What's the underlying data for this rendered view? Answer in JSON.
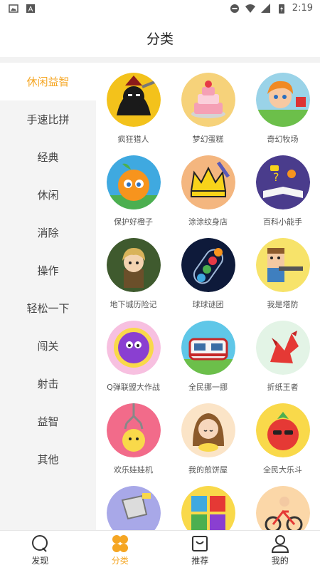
{
  "status_bar": {
    "time": "2:19"
  },
  "header": {
    "title": "分类"
  },
  "sidebar": {
    "items": [
      {
        "label": "休闲益智",
        "active": true
      },
      {
        "label": "手速比拼"
      },
      {
        "label": "经典"
      },
      {
        "label": "休闲"
      },
      {
        "label": "消除"
      },
      {
        "label": "操作"
      },
      {
        "label": "轻松一下"
      },
      {
        "label": "闯关"
      },
      {
        "label": "射击"
      },
      {
        "label": "益智"
      },
      {
        "label": "其他"
      }
    ]
  },
  "games": [
    {
      "name": "疯狂猎人",
      "icon": "hunter-icon"
    },
    {
      "name": "梦幻蛋糕",
      "icon": "cake-icon"
    },
    {
      "name": "奇幻牧场",
      "icon": "ranch-girl-icon"
    },
    {
      "name": "保护好橙子",
      "icon": "orange-icon"
    },
    {
      "name": "涂涂纹身店",
      "icon": "crown-tattoo-icon"
    },
    {
      "name": "百科小能手",
      "icon": "encyclopedia-book-icon"
    },
    {
      "name": "地下城历险记",
      "icon": "dungeon-hero-icon"
    },
    {
      "name": "球球谜团",
      "icon": "ball-tube-icon"
    },
    {
      "name": "我是塔防",
      "icon": "tower-defense-icon"
    },
    {
      "name": "Q弹联盟大作战",
      "icon": "purple-ball-icon"
    },
    {
      "name": "全民挪一挪",
      "icon": "train-icon"
    },
    {
      "name": "折纸王者",
      "icon": "paper-rooster-icon"
    },
    {
      "name": "欢乐娃娃机",
      "icon": "claw-machine-icon"
    },
    {
      "name": "我的煎饼屋",
      "icon": "pancake-girl-icon"
    },
    {
      "name": "全民大乐斗",
      "icon": "tomato-icon"
    },
    {
      "name": "",
      "icon": "saw-icon"
    },
    {
      "name": "",
      "icon": "jigsaw-icon"
    },
    {
      "name": "",
      "icon": "bike-icon"
    }
  ],
  "tabbar": {
    "tabs": [
      {
        "label": "发现",
        "icon": "discover-icon"
      },
      {
        "label": "分类",
        "icon": "category-icon",
        "active": true
      },
      {
        "label": "推荐",
        "icon": "recommend-bag-icon"
      },
      {
        "label": "我的",
        "icon": "profile-icon"
      }
    ]
  },
  "colors": {
    "accent": "#f5a623",
    "sidebar_bg": "#f4f4f4"
  }
}
